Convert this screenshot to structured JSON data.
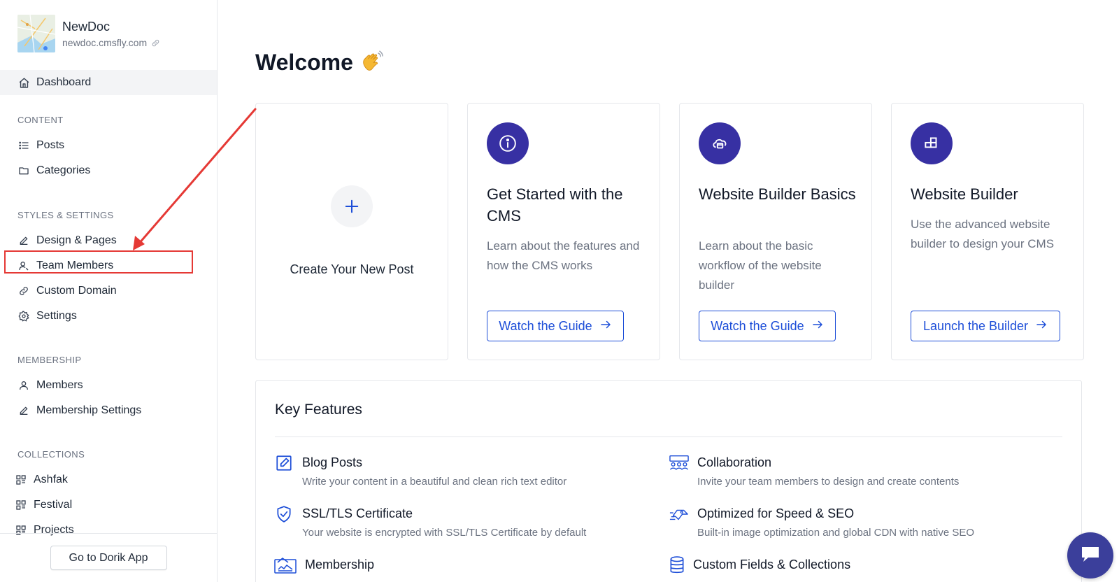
{
  "site": {
    "name": "NewDoc",
    "url": "newdoc.cmsfly.com"
  },
  "sidebar": {
    "dashboard_label": "Dashboard",
    "sections": {
      "content": {
        "title": "CONTENT",
        "items": [
          {
            "label": "Posts",
            "icon": "list-icon"
          },
          {
            "label": "Categories",
            "icon": "folder-icon"
          }
        ]
      },
      "styles": {
        "title": "STYLES & SETTINGS",
        "items": [
          {
            "label": "Design & Pages",
            "icon": "pencil-icon"
          },
          {
            "label": "Team Members",
            "icon": "user-icon"
          },
          {
            "label": "Custom Domain",
            "icon": "link-icon"
          },
          {
            "label": "Settings",
            "icon": "gear-icon"
          }
        ]
      },
      "membership": {
        "title": "MEMBERSHIP",
        "items": [
          {
            "label": "Members",
            "icon": "user-icon"
          },
          {
            "label": "Membership Settings",
            "icon": "pencil-icon"
          }
        ]
      },
      "collections": {
        "title": "COLLECTIONS",
        "items": [
          {
            "label": "Ashfak",
            "icon": "grid-icon"
          },
          {
            "label": "Festival",
            "icon": "grid-icon"
          },
          {
            "label": "Projects",
            "icon": "grid-icon"
          }
        ]
      }
    },
    "footer_button": "Go to Dorik App"
  },
  "main": {
    "welcome": "Welcome",
    "create_card": {
      "label": "Create Your New Post"
    },
    "cards": [
      {
        "title": "Get Started with the CMS",
        "description": "Learn about the features and how the CMS works",
        "button": "Watch the Guide",
        "icon": "info-icon"
      },
      {
        "title": "Website Builder Basics",
        "description": "Learn about the basic workflow of the website builder",
        "button": "Watch the Guide",
        "icon": "cloud-builder-icon"
      },
      {
        "title": "Website Builder",
        "description": "Use the advanced website builder to design your CMS",
        "button": "Launch the Builder",
        "icon": "blocks-icon"
      }
    ],
    "key_features": {
      "title": "Key Features",
      "items": [
        {
          "title": "Blog Posts",
          "description": "Write your content in a beautiful and clean rich text editor",
          "icon": "edit-square-icon"
        },
        {
          "title": "Collaboration",
          "description": "Invite your team members to design and create contents",
          "icon": "team-icon"
        },
        {
          "title": "SSL/TLS Certificate",
          "description": "Your website is encrypted with SSL/TLS Certificate by default",
          "icon": "shield-check-icon"
        },
        {
          "title": "Optimized for Speed & SEO",
          "description": "Built-in image optimization and global CDN with native SEO",
          "icon": "speed-icon"
        },
        {
          "title": "Membership",
          "description": "",
          "icon": "membership-icon"
        },
        {
          "title": "Custom Fields & Collections",
          "description": "",
          "icon": "database-icon"
        }
      ]
    }
  },
  "colors": {
    "accent": "#3730a3",
    "link": "#1d4ed8",
    "annotation": "#e53935"
  }
}
